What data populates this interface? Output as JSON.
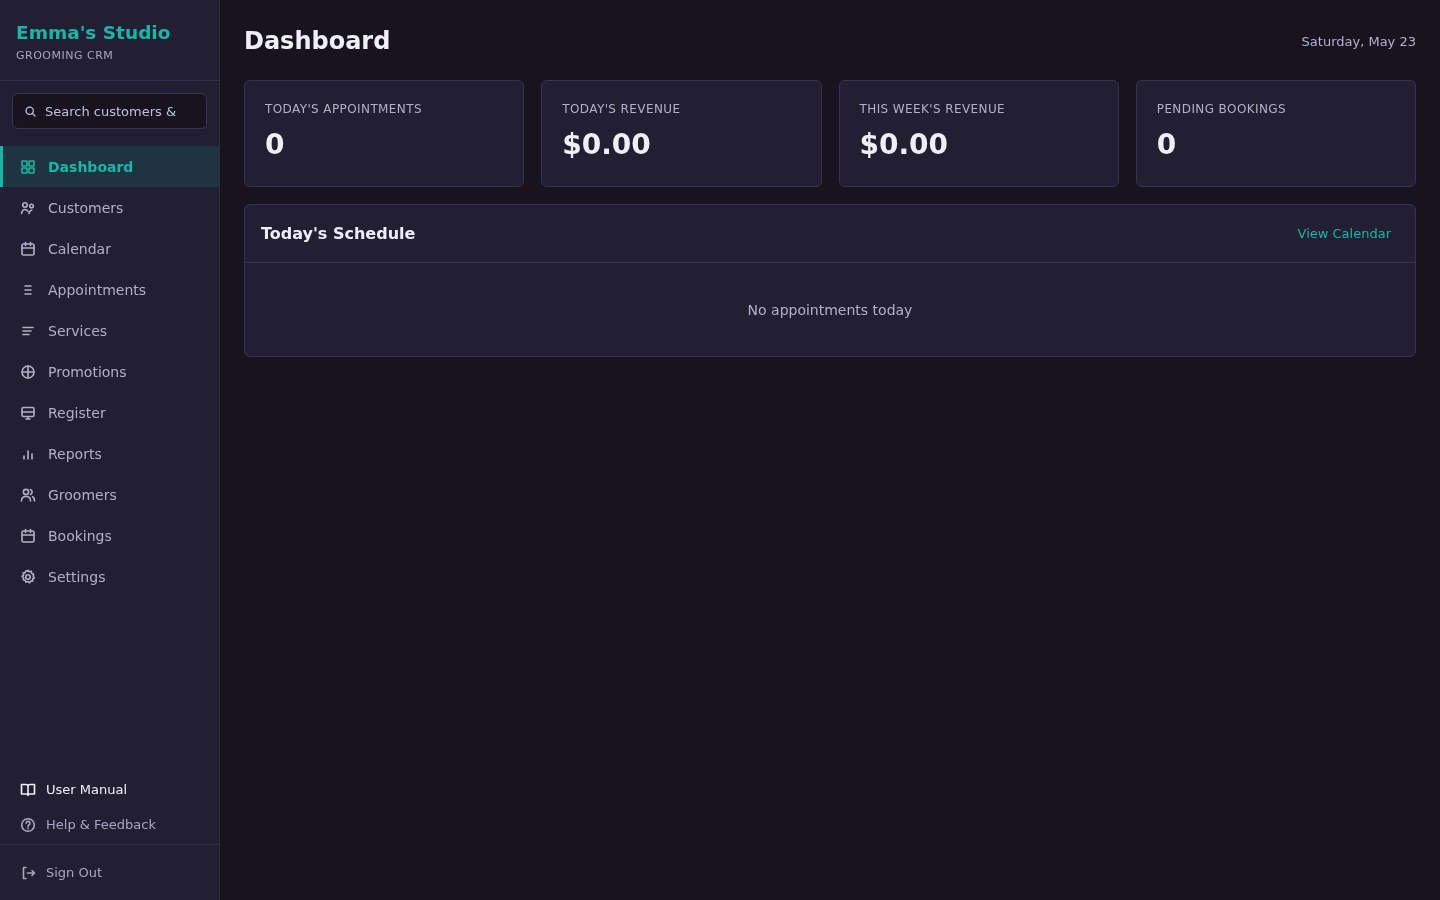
{
  "sidebar": {
    "brand": {
      "title": "Emma's Studio",
      "subtitle": "GROOMING CRM"
    },
    "search": {
      "placeholder": "Search customers &"
    },
    "nav_items": [
      {
        "label": "Dashboard",
        "selected": true
      },
      {
        "label": "Customers",
        "selected": false
      },
      {
        "label": "Calendar",
        "selected": false
      },
      {
        "label": "Appointments",
        "selected": false
      },
      {
        "label": "Services",
        "selected": false
      },
      {
        "label": "Promotions",
        "selected": false
      },
      {
        "label": "Register",
        "selected": false
      },
      {
        "label": "Reports",
        "selected": false
      },
      {
        "label": "Groomers",
        "selected": false
      },
      {
        "label": "Bookings",
        "selected": false
      },
      {
        "label": "Settings",
        "selected": false
      }
    ],
    "footer_links": [
      {
        "label": "User Manual",
        "kind": "primary"
      },
      {
        "label": "Help & Feedback",
        "kind": "secondary"
      }
    ],
    "sign_out": {
      "label": "Sign Out"
    }
  },
  "main": {
    "title": "Dashboard",
    "date": "Saturday, May 23",
    "stats": [
      {
        "label": "TODAY'S APPOINTMENTS",
        "value": "0"
      },
      {
        "label": "TODAY'S REVENUE",
        "value": "$0.00"
      },
      {
        "label": "THIS WEEK'S REVENUE",
        "value": "$0.00"
      },
      {
        "label": "PENDING BOOKINGS",
        "value": "0"
      }
    ],
    "schedule": {
      "title": "Today's Schedule",
      "link": "View Calendar",
      "empty_message": "No appointments today"
    }
  }
}
